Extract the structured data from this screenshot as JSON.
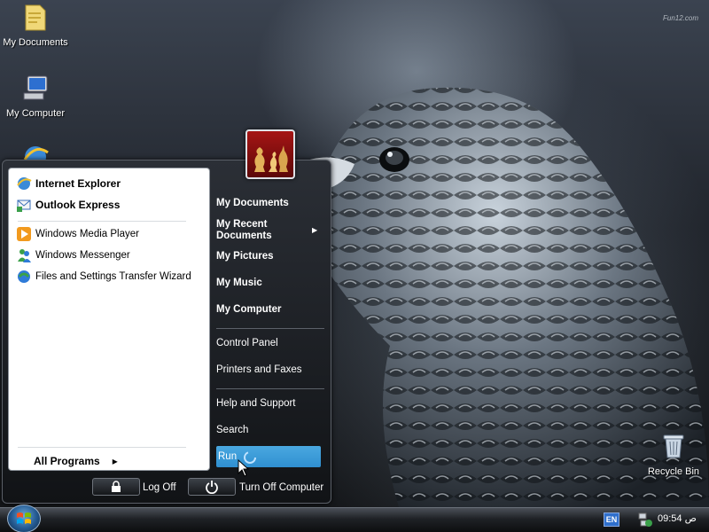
{
  "desktop": {
    "watermark": "Fun12.com",
    "icons": [
      {
        "label": "My Documents",
        "icon": "folder-documents-icon"
      },
      {
        "label": "My Computer",
        "icon": "computer-icon"
      },
      {
        "label": "",
        "icon": "internet-explorer-icon"
      },
      {
        "label": "Recycle Bin",
        "icon": "recycle-bin-icon"
      }
    ]
  },
  "start_menu": {
    "pinned": [
      {
        "label": "Internet Explorer",
        "icon": "internet-explorer-icon"
      },
      {
        "label": "Outlook Express",
        "icon": "outlook-express-icon"
      }
    ],
    "recent": [
      {
        "label": "Windows Media Player",
        "icon": "media-player-icon"
      },
      {
        "label": "Windows Messenger",
        "icon": "messenger-icon"
      },
      {
        "label": "Files and Settings Transfer Wizard",
        "icon": "transfer-wizard-icon"
      }
    ],
    "all_programs": "All Programs",
    "right_pane": {
      "my_documents": "My Documents",
      "my_recent_documents_1": "My Recent",
      "my_recent_documents_2": "Documents",
      "my_pictures": "My Pictures",
      "my_music": "My Music",
      "my_computer": "My Computer",
      "control_panel": "Control Panel",
      "printers_and_faxes": "Printers and Faxes",
      "help_and_support": "Help and Support",
      "search": "Search",
      "run": "Run"
    },
    "log_off": "Log Off",
    "turn_off": "Turn Off Computer"
  },
  "taskbar": {
    "language": "EN",
    "clock": "09:54 ص"
  },
  "colors": {
    "highlight": "#2f8fd0",
    "menu_dark": "#15171a",
    "user_tile": "#a51515"
  }
}
